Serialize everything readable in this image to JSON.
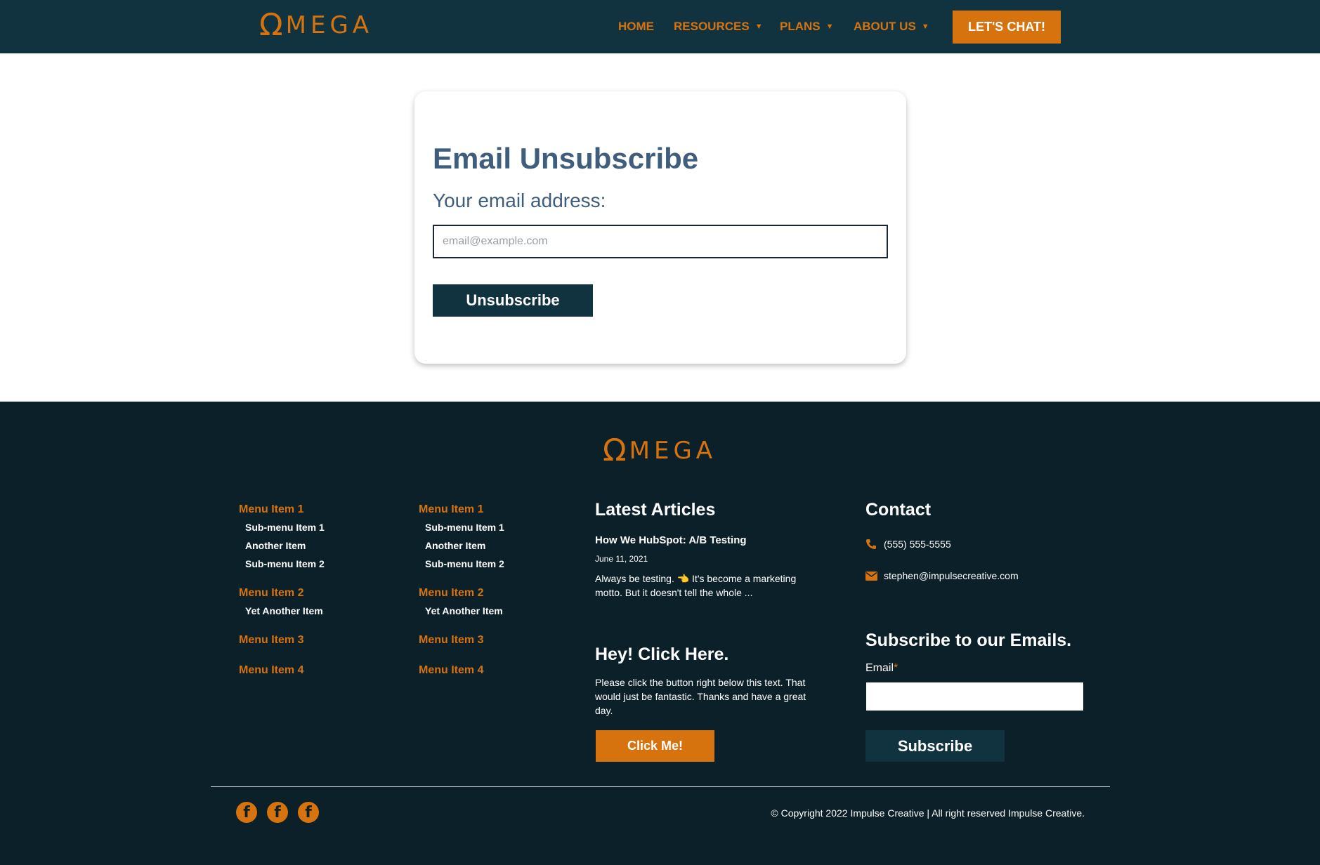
{
  "brand": {
    "omega": "Ω",
    "word": "MEGA"
  },
  "nav": {
    "items": [
      {
        "label": "HOME",
        "caret": ""
      },
      {
        "label": "RESOURCES",
        "caret": "▼"
      },
      {
        "label": "PLANS",
        "caret": "▼"
      },
      {
        "label": "ABOUT US",
        "caret": "▼"
      }
    ],
    "cta_label": "LET'S CHAT!"
  },
  "unsubscribe": {
    "title": "Email Unsubscribe",
    "label": "Your email address:",
    "placeholder": "email@example.com",
    "button_label": "Unsubscribe"
  },
  "footer": {
    "menus": [
      {
        "groups": [
          {
            "label": "Menu Item 1",
            "subs": [
              "Sub-menu Item 1",
              "Another Item",
              "Sub-menu Item 2"
            ]
          },
          {
            "label": "Menu Item 2",
            "subs": [
              "Yet Another Item"
            ]
          },
          {
            "label": "Menu Item 3",
            "subs": []
          },
          {
            "label": "Menu Item 4",
            "subs": []
          }
        ]
      },
      {
        "groups": [
          {
            "label": "Menu Item 1",
            "subs": [
              "Sub-menu Item 1",
              "Another Item",
              "Sub-menu Item 2"
            ]
          },
          {
            "label": "Menu Item 2",
            "subs": [
              "Yet Another Item"
            ]
          },
          {
            "label": "Menu Item 3",
            "subs": []
          },
          {
            "label": "Menu Item 4",
            "subs": []
          }
        ]
      }
    ],
    "articles": {
      "heading": "Latest Articles",
      "title": "How We HubSpot: A/B Testing",
      "date": "June 11, 2021",
      "excerpt": "Always be testing. 👈 It's become a marketing motto. But it doesn't tell the whole ..."
    },
    "promo": {
      "heading": "Hey! Click Here.",
      "text": "Please click the button right below this text. That would just be fantastic. Thanks and have a great day.",
      "button_label": "Click Me!"
    },
    "contact": {
      "heading": "Contact",
      "phone": "(555) 555-5555",
      "email": "stephen@impulsecreative.com"
    },
    "subscribe": {
      "heading": "Subscribe to our Emails.",
      "label": "Email",
      "required_mark": "*",
      "button_label": "Subscribe"
    },
    "social": [
      {
        "icon": "facebook-icon",
        "glyph": "f"
      },
      {
        "icon": "facebook-icon",
        "glyph": "f"
      },
      {
        "icon": "facebook-icon",
        "glyph": "f"
      }
    ],
    "copyright": "© Copyright 2022 Impulse Creative | All right reserved Impulse Creative."
  },
  "colors": {
    "header_bg": "#113340",
    "footer_bg": "#0c2029",
    "accent": "#d6730f",
    "title": "#3f5e7e"
  }
}
